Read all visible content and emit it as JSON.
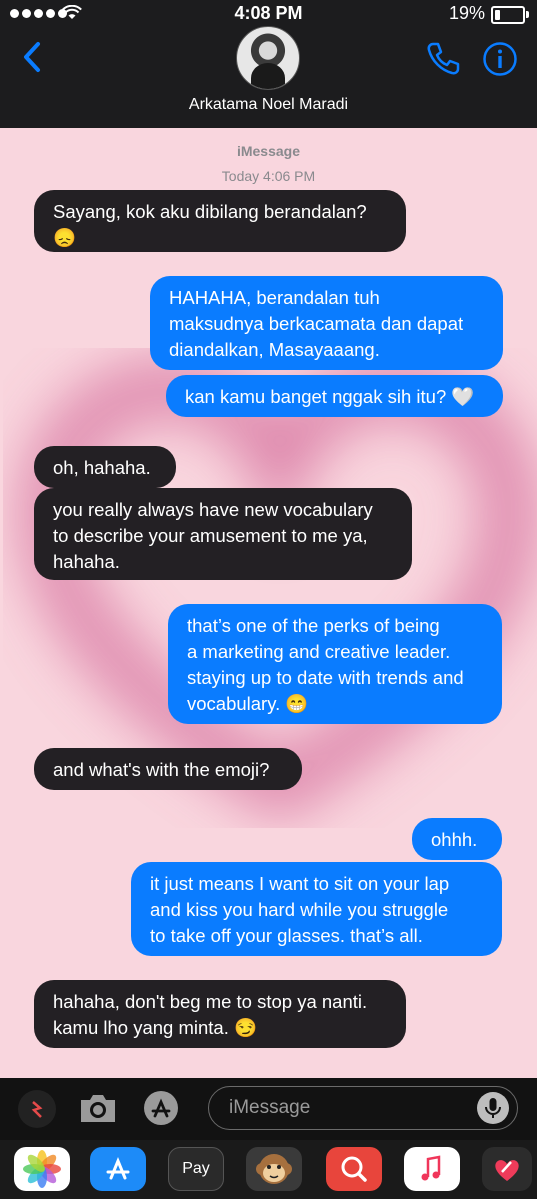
{
  "status_bar": {
    "time": "4:08 PM",
    "battery": "19%"
  },
  "header": {
    "contact_name": "Arkatama Noel Maradi"
  },
  "thread": {
    "service": "iMessage",
    "timestamp": "Today 4:06 PM"
  },
  "messages": [
    {
      "dir": "in",
      "text": "Sayang, kok aku dibilang berandalan?\n😞"
    },
    {
      "dir": "out",
      "text": "HAHAHA, berandalan tuh\nmaksudnya berkacamata dan dapat\ndiandalkan, Masayaaang."
    },
    {
      "dir": "out",
      "text": "kan kamu banget nggak sih itu? 🤍"
    },
    {
      "dir": "in",
      "text": "oh, hahaha."
    },
    {
      "dir": "in",
      "text": "you really always have new vocabulary\nto describe your amusement to me ya,\nhahaha."
    },
    {
      "dir": "out",
      "text": "that’s one of the perks of being\na marketing and creative leader.\nstaying up to date with trends and\nvocabulary. 😁"
    },
    {
      "dir": "in",
      "text": "and what's with the emoji?"
    },
    {
      "dir": "out",
      "text": "ohhh."
    },
    {
      "dir": "out",
      "text": "it just means I want to sit on your lap\nand kiss you hard while you struggle\nto take off your glasses. that’s all."
    },
    {
      "dir": "in",
      "text": "hahaha, don't beg me to stop ya nanti.\nkamu lho yang minta. 😏"
    }
  ],
  "composer": {
    "placeholder": "iMessage"
  },
  "app_drawer": {
    "apple_pay_label": " Pay"
  },
  "colors": {
    "outgoing": "#0a7cff",
    "incoming": "#232024",
    "background": "#f9d6de",
    "accent": "#0a7cff"
  },
  "icons": [
    "back-chevron-icon",
    "phone-icon",
    "info-icon",
    "camera-icon",
    "app-store-icon",
    "microphone-icon",
    "photos-icon",
    "animoji-icon",
    "search-icon",
    "music-icon",
    "heart-icon"
  ]
}
